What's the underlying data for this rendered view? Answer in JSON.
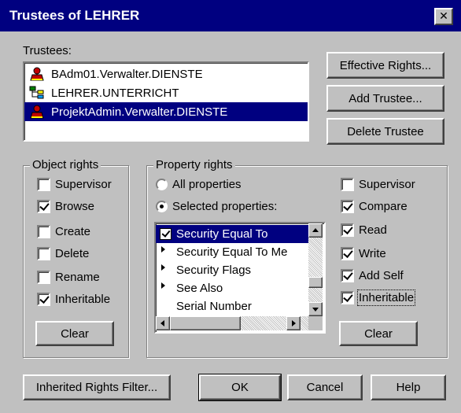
{
  "dialog": {
    "title": "Trustees of LEHRER"
  },
  "trustees": {
    "label": "Trustees:",
    "items": [
      {
        "name": "BAdm01.Verwalter.DIENSTE",
        "icon": "user-icon",
        "selected": false
      },
      {
        "name": "LEHRER.UNTERRICHT",
        "icon": "org-unit-icon",
        "selected": false
      },
      {
        "name": "ProjektAdmin.Verwalter.DIENSTE",
        "icon": "user-icon",
        "selected": true
      }
    ]
  },
  "side_buttons": {
    "effective_rights": "Effective Rights...",
    "add_trustee": "Add Trustee...",
    "delete_trustee": "Delete Trustee"
  },
  "object_rights": {
    "legend": "Object rights",
    "items": [
      {
        "label": "Supervisor",
        "checked": false
      },
      {
        "label": "Browse",
        "checked": true
      },
      {
        "label": "Create",
        "checked": false
      },
      {
        "label": "Delete",
        "checked": false
      },
      {
        "label": "Rename",
        "checked": false
      },
      {
        "label": "Inheritable",
        "checked": true
      }
    ],
    "clear_label": "Clear"
  },
  "property_rights": {
    "legend": "Property rights",
    "all_properties": "All properties",
    "selected_properties": "Selected properties:",
    "selected_option": "selected_properties",
    "list": [
      {
        "label": "Security Equal To",
        "mark": "checked",
        "selected": true
      },
      {
        "label": "Security Equal To Me",
        "mark": "arrow",
        "selected": false
      },
      {
        "label": "Security Flags",
        "mark": "arrow",
        "selected": false
      },
      {
        "label": "See Also",
        "mark": "arrow",
        "selected": false
      },
      {
        "label": "Serial Number",
        "mark": "none",
        "selected": false
      }
    ],
    "rights": [
      {
        "label": "Supervisor",
        "checked": false
      },
      {
        "label": "Compare",
        "checked": true
      },
      {
        "label": "Read",
        "checked": true
      },
      {
        "label": "Write",
        "checked": true
      },
      {
        "label": "Add Self",
        "checked": true
      },
      {
        "label": "Inheritable",
        "checked": true
      }
    ],
    "clear_label": "Clear"
  },
  "footer": {
    "inherited_rights_filter": "Inherited Rights Filter...",
    "ok": "OK",
    "cancel": "Cancel",
    "help": "Help"
  },
  "colors": {
    "title_bar": "#000080",
    "face": "#c0c0c0",
    "selection": "#000080"
  }
}
